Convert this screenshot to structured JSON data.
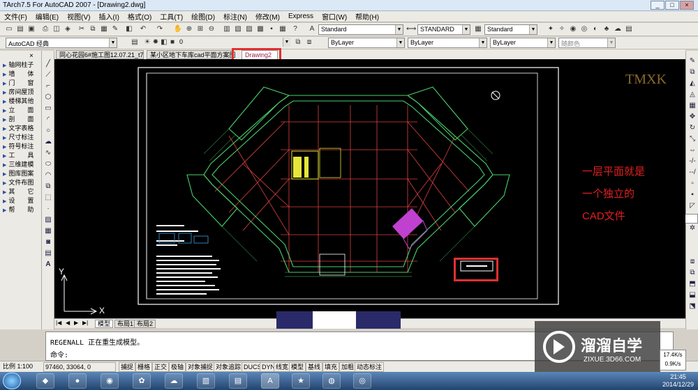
{
  "window": {
    "title": "TArch7.5 For AutoCAD 2007 - [Drawing2.dwg]"
  },
  "menu": [
    "文件(F)",
    "编辑(E)",
    "视图(V)",
    "插入(I)",
    "格式(O)",
    "工具(T)",
    "绘图(D)",
    "标注(N)",
    "修改(M)",
    "Express",
    "窗口(W)",
    "帮助(H)"
  ],
  "toolbar": {
    "workspace": "AutoCAD 经典",
    "text_style": "Standard",
    "dim_style": "STANDARD",
    "table_style": "Standard",
    "layer": "0",
    "color": "ByLayer",
    "linetype": "ByLayer",
    "lineweight": "ByLayer",
    "plotstyle": "随颜色"
  },
  "sidebar": {
    "items": [
      "轴网柱子",
      "墙　　体",
      "门　　窗",
      "房间屋顶",
      "楼梯其他",
      "立　　面",
      "剖　　面",
      "文字表格",
      "尺寸标注",
      "符号标注",
      "工　　具",
      "三维建模",
      "图库图案",
      "文件布图",
      "其　　它",
      "设　　置",
      "帮　　助"
    ]
  },
  "doc_tabs": [
    {
      "label": "同心花园6#施工图12.07.21_t7",
      "active": false
    },
    {
      "label": "某小区地下车库cad平面方案图",
      "active": false
    },
    {
      "label": "Drawing2",
      "active": true
    }
  ],
  "canvas": {
    "watermark_text": "TMXK",
    "annotation_lines": [
      "一层平面就是",
      "一个独立的",
      "CAD文件"
    ],
    "ucs_x": "X",
    "ucs_y": "Y"
  },
  "layout_tabs": [
    "模型",
    "布局1",
    "布局2"
  ],
  "command": {
    "line1": "REGENALL 正在重生成模型。",
    "prompt": "命令:"
  },
  "status": {
    "scale": "比例 1:100",
    "coords": "97460, 33064, 0",
    "toggles": [
      "捕捉",
      "栅格",
      "正交",
      "极轴",
      "对象捕捉",
      "对象追踪",
      "DUCS",
      "DYN",
      "线宽",
      "模型",
      "基线",
      "填充",
      "加粗",
      "动态标注"
    ]
  },
  "watermark": {
    "name": "溜溜自学",
    "url": "ZIXUE.3D66.COM"
  },
  "network": {
    "up": "17.4K/s",
    "down": "0.9K/s"
  },
  "clock": {
    "time": "21:45",
    "date": "2014/12/29"
  },
  "colors": {
    "annotation": "#e22020",
    "highlight": "#e23030",
    "grid": "#e04040",
    "walls": "#4ad06a"
  }
}
